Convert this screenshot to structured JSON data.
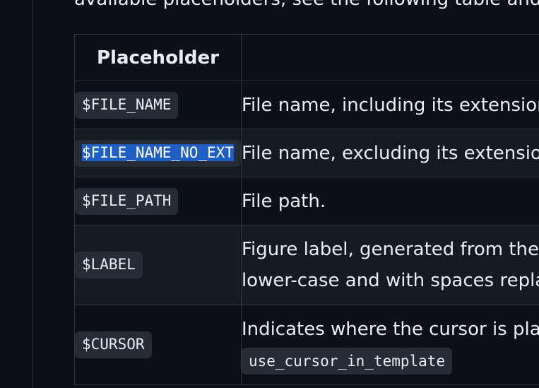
{
  "intro_text": "available placeholders, see the following table and",
  "table": {
    "headers": [
      "Placeholder",
      ""
    ],
    "rows": [
      {
        "placeholder": "$FILE_NAME",
        "description": [
          "File name, including its extension."
        ]
      },
      {
        "placeholder": "$FILE_NAME_NO_EXT",
        "description": [
          "File name, excluding its extension."
        ],
        "selected": true
      },
      {
        "placeholder": "$FILE_PATH",
        "description": [
          "File path."
        ]
      },
      {
        "placeholder": "$LABEL",
        "description": [
          "Figure label, generated from the file name,",
          "lower-case and with spaces replaced by hyphens."
        ]
      },
      {
        "placeholder": "$CURSOR",
        "description": [
          "Indicates where the cursor is placed."
        ],
        "code": "use_cursor_in_template"
      }
    ]
  },
  "colors": {
    "background": "#0d1117",
    "border": "#30363d",
    "code_bg": "#262c36",
    "selection": "#1f5fc4"
  }
}
